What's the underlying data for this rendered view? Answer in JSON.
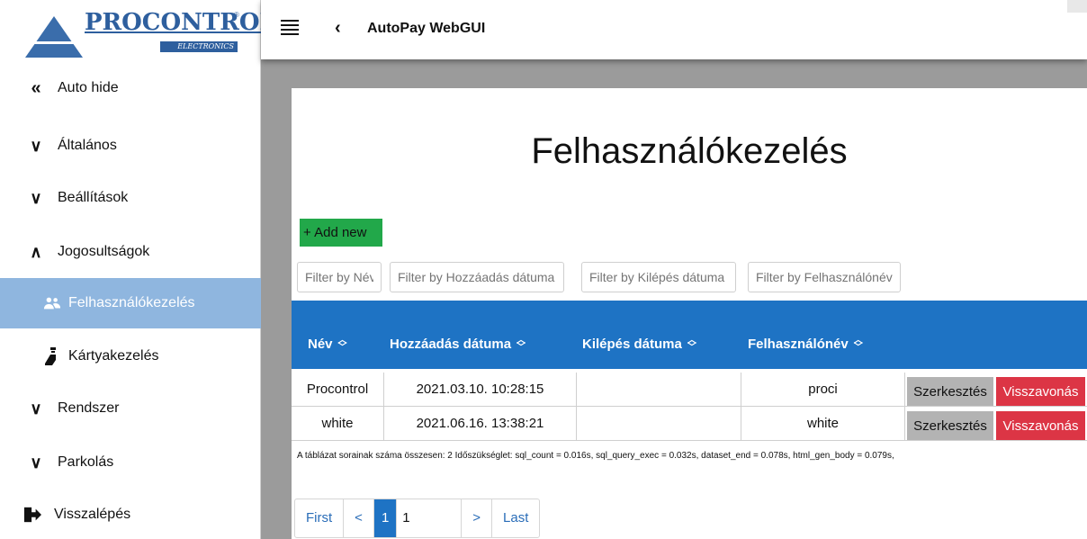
{
  "logo": {
    "brand": "PROCONTROL",
    "sub": "ELECTRONICS",
    "reg": "®"
  },
  "sidebar": {
    "items": [
      {
        "label": "Auto hide",
        "icon": "double-chevron-left-icon"
      },
      {
        "label": "Általános",
        "icon": "chevron-down-icon"
      },
      {
        "label": "Beállítások",
        "icon": "chevron-down-icon"
      },
      {
        "label": "Jogosultságok",
        "icon": "chevron-up-icon"
      },
      {
        "label": "Felhasználókezelés",
        "icon": "users-icon",
        "active": true
      },
      {
        "label": "Kártyakezelés",
        "icon": "card-reader-icon"
      },
      {
        "label": "Rendszer",
        "icon": "chevron-down-icon"
      },
      {
        "label": "Parkolás",
        "icon": "chevron-down-icon"
      },
      {
        "label": "Visszalépés",
        "icon": "logout-icon"
      }
    ]
  },
  "topbar": {
    "title": "AutoPay WebGUI"
  },
  "main": {
    "title": "Felhasználókezelés",
    "add_label": "+ Add new",
    "filters": [
      {
        "placeholder": "Filter by Név"
      },
      {
        "placeholder": "Filter by Hozzáadás dátuma"
      },
      {
        "placeholder": "Filter by Kilépés dátuma"
      },
      {
        "placeholder": "Filter by Felhasználónév"
      }
    ],
    "columns": [
      "Név",
      "Hozzáadás dátuma",
      "Kilépés dátuma",
      "Felhasználónév"
    ],
    "rows": [
      {
        "name": "Procontrol",
        "added": "2021.03.10. 10:28:15",
        "left": "",
        "username": "proci"
      },
      {
        "name": "white",
        "added": "2021.06.16. 13:38:21",
        "left": "",
        "username": "white"
      }
    ],
    "edit_label": "Szerkesztés",
    "revoke_label": "Visszavonás",
    "stats": "A táblázat sorainak száma összesen: 2   Időszükséglet: sql_count = 0.016s, sql_query_exec = 0.032s, dataset_end = 0.078s, html_gen_body = 0.079s,",
    "pager": {
      "first": "First",
      "prev": "<",
      "current": "1",
      "page_input": "1",
      "next": ">",
      "last": "Last"
    }
  },
  "colors": {
    "accent": "#1e73c4",
    "add": "#22a84a",
    "revoke": "#dc3545",
    "sidebar_active": "#8fb6df"
  }
}
